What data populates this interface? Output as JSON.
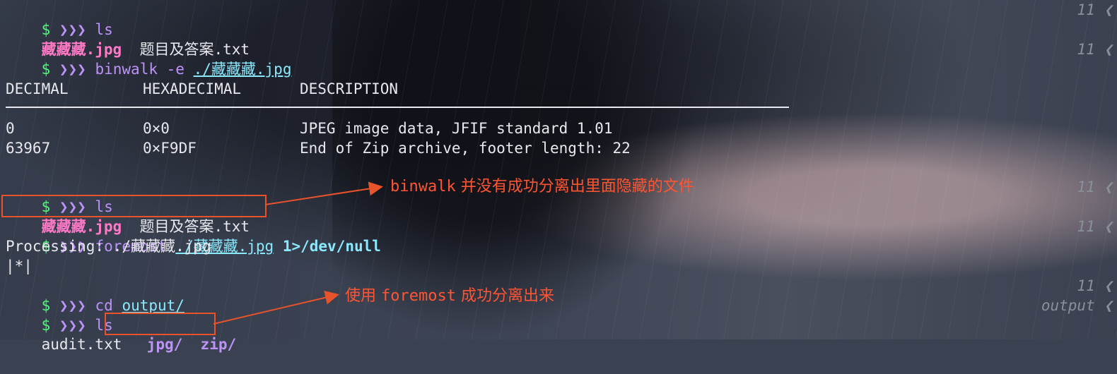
{
  "prompt": {
    "dollar": "$",
    "arrows": "❯❯❯"
  },
  "lines": [
    {
      "cmd": "ls",
      "right": "11 ❮"
    },
    {
      "files": [
        "藏藏藏.jpg",
        "题目及答案.txt"
      ]
    },
    {
      "cmd": "binwalk",
      "args": "-e",
      "path": "./藏藏藏.jpg",
      "right": "11 ❮"
    },
    {
      "header": [
        "DECIMAL",
        "HEXADECIMAL",
        "DESCRIPTION"
      ]
    },
    {
      "rows": [
        [
          "0",
          "0×0",
          "JPEG image data, JFIF standard 1.01"
        ],
        [
          "63967",
          "0×F9DF",
          "End of Zip archive, footer length: 22"
        ]
      ]
    },
    {
      "cmd": "ls",
      "right": "11 ❮"
    },
    {
      "files": [
        "藏藏藏.jpg",
        "题目及答案.txt"
      ]
    },
    {
      "cmd": "foremost",
      "path": "./藏藏藏.jpg",
      "redirect": "1>/dev/null",
      "right": "11 ❮"
    },
    {
      "output": [
        "Processing: ./藏藏藏.jpg",
        "|*|"
      ]
    },
    {
      "cmd": "cd",
      "path": "output/",
      "right": "11 ❮"
    },
    {
      "cmd": "ls",
      "right": "output ❮"
    },
    {
      "files": [
        "audit.txt",
        "jpg/",
        "zip/"
      ]
    }
  ],
  "annotations": {
    "binwalk_note": {
      "prefix": "binwalk",
      "text": "并没有成功分离出里面隐藏的文件"
    },
    "foremost_note": {
      "prefix": "使用",
      "mid": "foremost",
      "text": "成功分离出来"
    }
  },
  "colors": {
    "annotation": "#e8532c",
    "prompt_green": "#50fa7b",
    "prompt_purple": "#bd93f9",
    "link_cyan": "#8be9fd",
    "file_pink": "#ff79c6"
  }
}
